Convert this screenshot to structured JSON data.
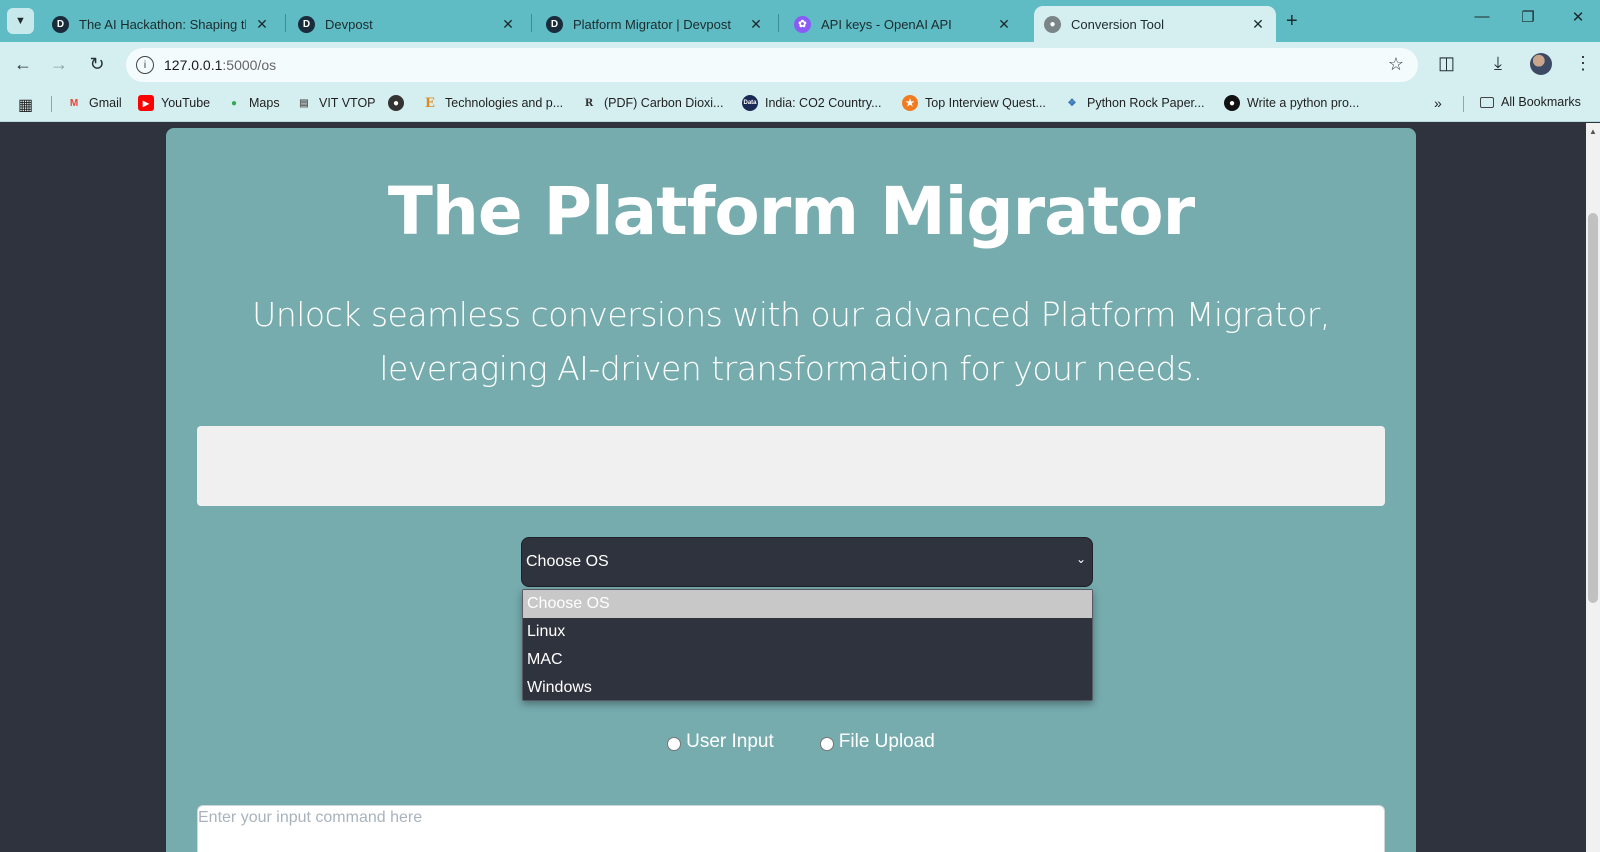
{
  "browser": {
    "tabs": [
      {
        "title": "The AI Hackathon: Shaping the",
        "favicon": "D",
        "favicon_color": "#1a2b3c"
      },
      {
        "title": "Devpost",
        "favicon": "D",
        "favicon_color": "#1a2b3c"
      },
      {
        "title": "Platform Migrator | Devpost",
        "favicon": "D",
        "favicon_color": "#1a2b3c"
      },
      {
        "title": "API keys - OpenAI API",
        "favicon": "openai-icon",
        "favicon_color": "#8a5cf5"
      },
      {
        "title": "Conversion Tool",
        "favicon": "globe-icon",
        "favicon_color": "#555555",
        "active": true
      }
    ],
    "url_host": "127.0.0.1",
    "url_path": ":5000/os",
    "bookmarks": [
      {
        "label": "Gmail",
        "icon": "gmail-icon"
      },
      {
        "label": "YouTube",
        "icon": "youtube-icon"
      },
      {
        "label": "Maps",
        "icon": "maps-icon"
      },
      {
        "label": "VIT VTOP",
        "icon": "vtop-icon"
      },
      {
        "label": "",
        "icon": "globe-icon"
      },
      {
        "label": "Technologies and p...",
        "icon": "e-icon"
      },
      {
        "label": "(PDF) Carbon Dioxi...",
        "icon": "researchgate-icon"
      },
      {
        "label": "India: CO2 Country...",
        "icon": "data-icon"
      },
      {
        "label": "Top Interview Quest...",
        "icon": "leetcode-icon"
      },
      {
        "label": "Python Rock Paper...",
        "icon": "python-icon"
      },
      {
        "label": "Write a python pro...",
        "icon": "github-icon"
      }
    ],
    "all_bookmarks": "All Bookmarks"
  },
  "page": {
    "title": "The Platform Migrator",
    "subtitle": "Unlock seamless conversions with our advanced Platform Migrator, leveraging AI-driven transformation for your needs.",
    "os_select": {
      "selected": "Choose OS",
      "options": [
        "Choose OS",
        "Linux",
        "MAC",
        "Windows"
      ]
    },
    "radio_user_input": "User Input",
    "radio_file_upload": "File Upload",
    "input_placeholder": "Enter your input command here"
  },
  "colors": {
    "tab_bar": "#5fbcc4",
    "toolbar": "#d5eff1",
    "card": "#76acae",
    "page_bg": "#2f333d",
    "select_bg": "#2f333d"
  }
}
